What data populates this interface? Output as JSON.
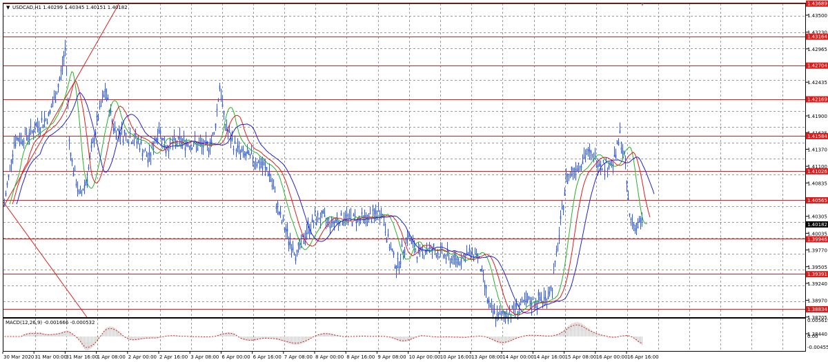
{
  "header": {
    "symbol_info": "USDCAD,H1  1.40299 1.40345 1.40151 1.40182"
  },
  "macd": {
    "label": "MACD(12,26,9) -0.001666 -0.000532",
    "scale_labels": [
      "0.005619",
      "0.00",
      "-0.004556"
    ]
  },
  "price_scale": [
    "1.43500",
    "1.43230",
    "1.42965",
    "1.42435",
    "1.41900",
    "1.41635",
    "1.41370",
    "1.41100",
    "1.40835",
    "1.40305",
    "1.40035",
    "1.39770",
    "1.39505",
    "1.39240",
    "1.38970",
    "1.38705",
    "1.38440"
  ],
  "levels": [
    {
      "label": "1.43689",
      "price": 1.43689
    },
    {
      "label": "1.43164",
      "price": 1.43164
    },
    {
      "label": "1.42704",
      "price": 1.42704
    },
    {
      "label": "1.42169",
      "price": 1.42169
    },
    {
      "label": "1.41584",
      "price": 1.41584
    },
    {
      "label": "1.41026",
      "price": 1.41026
    },
    {
      "label": "1.40565",
      "price": 1.40565
    },
    {
      "label": "1.39946",
      "price": 1.39946
    },
    {
      "label": "1.39391",
      "price": 1.39391
    },
    {
      "label": "1.38834",
      "price": 1.38834
    }
  ],
  "current_price": {
    "label": "1.40182",
    "price": 1.40182
  },
  "time_labels": [
    "30 Mar 2020",
    "31 Mar 00:00",
    "31 Mar 16:00",
    "1 Apr 08:00",
    "2 Apr 00:00",
    "2 Apr 16:00",
    "3 Apr 08:00",
    "6 Apr 00:00",
    "6 Apr 16:00",
    "7 Apr 08:00",
    "8 Apr 00:00",
    "8 Apr 16:00",
    "9 Apr 08:00",
    "10 Apr 00:00",
    "10 Apr 16:00",
    "13 Apr 08:00",
    "14 Apr 00:00",
    "14 Apr 16:00",
    "15 Apr 08:00",
    "16 Apr 00:00",
    "16 Apr 16:00"
  ],
  "colors": {
    "price_bars": "#2f5bd6",
    "ma_fast": "#22b422",
    "ma_mid": "#e01b1b",
    "ma_slow": "#1e1ed8",
    "levels": "#e01b1b",
    "grid": "#9a9a9a",
    "current_badge": "#000000"
  }
}
